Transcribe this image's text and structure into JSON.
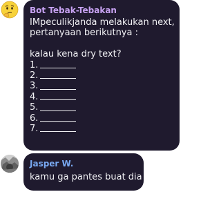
{
  "messages": [
    {
      "sender": "Bot Tebak-Tebakan",
      "avatar_icon": "thinking-face-emoji-icon",
      "lines": [
        "IMpeculikjanda melakukan next,",
        "pertanyaan berikutnya :",
        "",
        "kalau kena dry text?"
      ],
      "list": [
        "1.",
        "2.",
        "3.",
        "4.",
        "5.",
        "6.",
        "7."
      ]
    },
    {
      "sender": "Jasper W.",
      "avatar_icon": "profile-photo-icon",
      "text": "kamu ga pantes buat dia"
    }
  ],
  "colors": {
    "bubble_bg": "#1f1a2e",
    "bot_name": "#c7a2f2",
    "user_name": "#79a9f2",
    "text": "#f2f2f5"
  }
}
